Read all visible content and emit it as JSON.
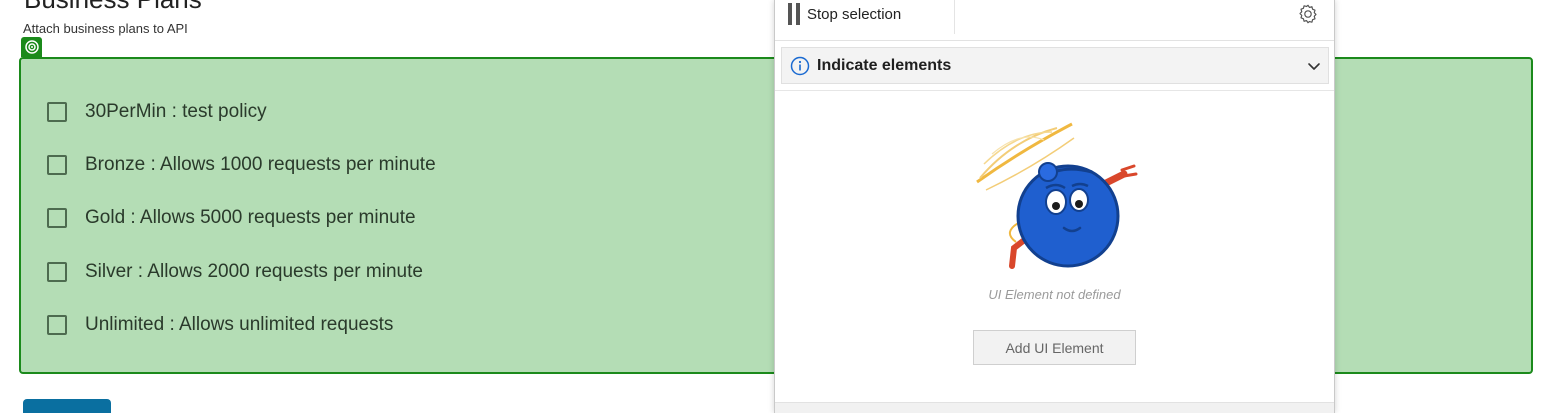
{
  "page": {
    "title": "Business Plans",
    "subtitle": "Attach business plans to API"
  },
  "plans": [
    {
      "label": "30PerMin : test policy",
      "checked": false
    },
    {
      "label": "Bronze : Allows 1000 requests per minute",
      "checked": false
    },
    {
      "label": "Gold : Allows 5000 requests per minute",
      "checked": false
    },
    {
      "label": "Silver : Allows 2000 requests per minute",
      "checked": false
    },
    {
      "label": "Unlimited : Allows unlimited requests",
      "checked": false
    }
  ],
  "panel": {
    "stop_label": "Stop selection",
    "pause_icon": "pause-icon",
    "gear_icon": "gear-icon",
    "section_title": "Indicate elements",
    "info_icon": "info-icon",
    "chevron_icon": "chevron-down-icon",
    "empty_text": "UI Element not defined",
    "add_button_label": "Add UI Element"
  },
  "colors": {
    "highlight_fill": "#b4ddb5",
    "highlight_border": "#1b8a1b",
    "primary_button": "#0a6fa0",
    "mascot_blue": "#1f5fcf",
    "mascot_accent": "#d9472b"
  }
}
